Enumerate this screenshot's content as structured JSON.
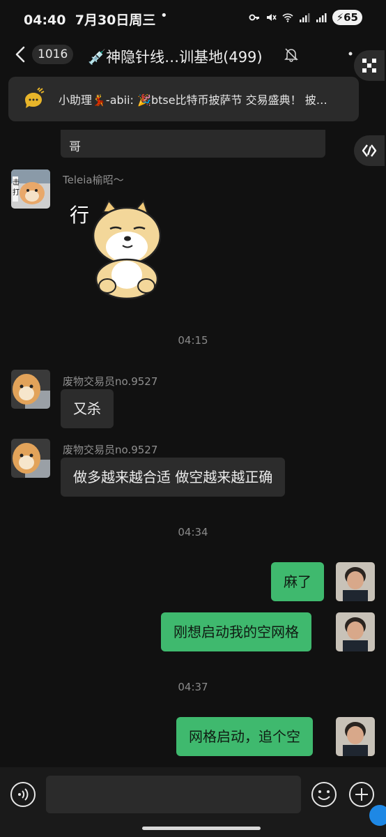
{
  "status_bar": {
    "time": "04:40",
    "date": "7月30日周三",
    "battery": "65"
  },
  "nav": {
    "unread_count": "1016",
    "title": "💉神隐针线…训基地(499)"
  },
  "notice": {
    "text": "小助理💃-abii: 🎉btse比特币披萨节 交易盛典！ 披…"
  },
  "messages": {
    "partial_text": "哥",
    "m1_sender": "Teleia榆昭～",
    "sticker_caption": "行",
    "ts1": "04:15",
    "m2_sender": "废物交易员no.9527",
    "m2_text": "又杀",
    "m3_sender": "废物交易员no.9527",
    "m3_text": "做多越来越合适 做空越来越正确",
    "ts2": "04:34",
    "m4_text": "麻了",
    "m5_text": "刚想启动我的空网格",
    "ts3": "04:37",
    "m6_text": "网格启动，追个空"
  },
  "input": {
    "placeholder": ""
  },
  "colors": {
    "background": "#111111",
    "bubble_in": "#2c2c2c",
    "bubble_out": "#3fb96e",
    "notice_icon": "#e8b52a"
  }
}
